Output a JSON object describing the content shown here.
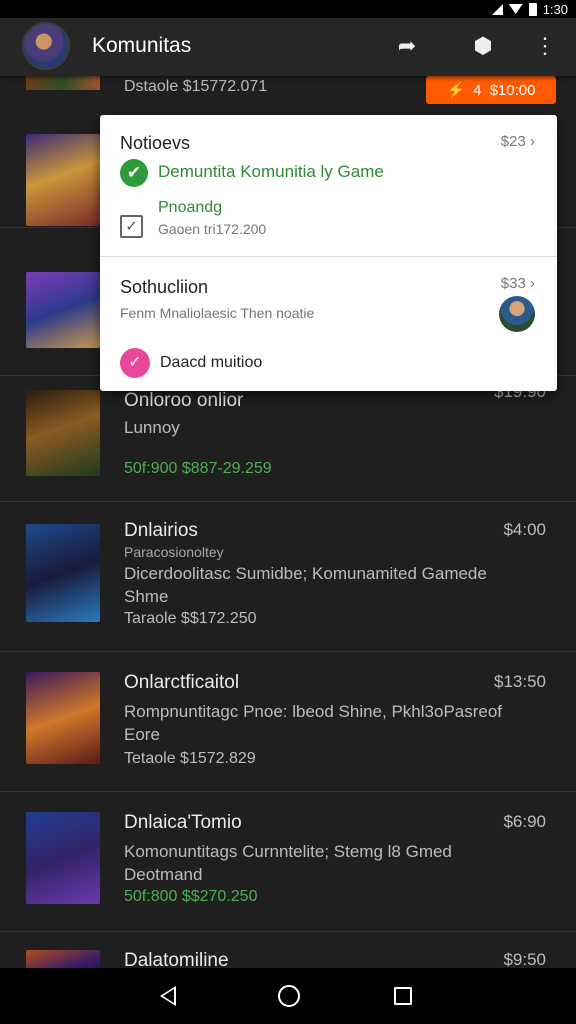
{
  "status_bar": {
    "time": "1:30",
    "icons": [
      "signal-icon",
      "wifi-icon",
      "battery-icon"
    ]
  },
  "app_bar": {
    "title": "Komunitas",
    "actions": [
      {
        "name": "share-icon",
        "glyph": "➦"
      },
      {
        "name": "shield-icon",
        "glyph": "⬢"
      },
      {
        "name": "more-icon",
        "glyph": "⋮"
      }
    ]
  },
  "top_partial": {
    "text": "Dstaole $15772.071",
    "badge_count": "4",
    "badge_price": "$10:00",
    "badge_color": "#ff5a00"
  },
  "items": [
    {
      "name": "",
      "price": "",
      "sub": "",
      "desc": "",
      "meta": "",
      "meta_green": false
    },
    {
      "name": "",
      "price": "",
      "sub": "",
      "desc": "",
      "meta": "",
      "meta_green": false
    },
    {
      "name": "Onloroo onlior",
      "price": "$19:90",
      "sub": "",
      "desc": "Lunnoy",
      "meta": "50f:900 $887-29.259",
      "meta_green": true
    },
    {
      "name": "Dnlairios",
      "price": "$4:00",
      "sub": "Paracosionoltey",
      "desc": "Dicerdoolitasc Sumidbe; Komunamited Gamede Shme",
      "meta": "Taraole $$172.250",
      "meta_green": false
    },
    {
      "name": "Onlarctficaitol",
      "price": "$13:50",
      "sub": "",
      "desc": "Rompnuntitagc Pnoe: lbeod Shine, Pkhl3oPasreof Eore",
      "meta": "Tetaole $1572.829",
      "meta_green": false
    },
    {
      "name": "Dnlaica'Tomio",
      "price": "$6:90",
      "sub": "",
      "desc": "Komonuntitags Curnntelite; Stemg l8 Gmed Deotmand",
      "meta": "50f:800 $$270.250",
      "meta_green": true
    },
    {
      "name": "Dalatomiline",
      "price": "$9:50",
      "sub": "",
      "desc": "",
      "meta": "",
      "meta_green": false
    }
  ],
  "popup": {
    "section1": {
      "header": "Notioevs",
      "price": "$23",
      "ok_label": "Demuntita Komunitia ly Game",
      "check_title": "Pnoandg",
      "check_sub": "Gaoen tri172.200"
    },
    "section2": {
      "header": "Sothucliion",
      "price": "$33",
      "solution_text": "Fenm Mnaliolaesic Then noatie",
      "pink_label": "Daacd muitioo"
    },
    "colors": {
      "ok": "#2e9b3a",
      "pink": "#e8479a"
    }
  },
  "nav_bar": {
    "buttons": [
      "back-icon",
      "home-icon",
      "recents-icon"
    ]
  }
}
